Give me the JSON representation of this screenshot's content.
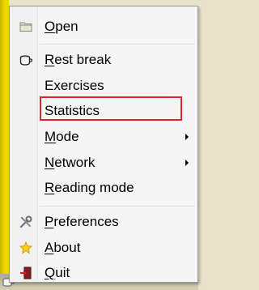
{
  "menu": {
    "items": [
      {
        "id": "open",
        "label": "Open",
        "mnemonic": "O",
        "rest": "pen",
        "icon": "folder-icon",
        "submenu": false
      },
      {
        "id": "rest-break",
        "label": "Rest break",
        "mnemonic": "R",
        "rest": "est break",
        "icon": "coffee-cup-icon",
        "submenu": false
      },
      {
        "id": "exercises",
        "label": "Exercises",
        "mnemonic": "",
        "rest": "Exercises",
        "icon": "",
        "submenu": false
      },
      {
        "id": "statistics",
        "label": "Statistics",
        "mnemonic": "",
        "rest": "Statistics",
        "icon": "",
        "submenu": false
      },
      {
        "id": "mode",
        "label": "Mode",
        "mnemonic": "M",
        "rest": "ode",
        "icon": "",
        "submenu": true
      },
      {
        "id": "network",
        "label": "Network",
        "mnemonic": "N",
        "rest": "etwork",
        "icon": "",
        "submenu": true
      },
      {
        "id": "reading-mode",
        "label": "Reading mode",
        "mnemonic": "R",
        "rest": "eading mode",
        "icon": "",
        "submenu": false
      },
      {
        "id": "preferences",
        "label": "Preferences",
        "mnemonic": "P",
        "rest": "references",
        "icon": "tools-icon",
        "submenu": false
      },
      {
        "id": "about",
        "label": "About",
        "mnemonic": "A",
        "rest": "bout",
        "icon": "star-icon",
        "submenu": false
      },
      {
        "id": "quit",
        "label": "Quit",
        "mnemonic": "Q",
        "rest": "uit",
        "icon": "exit-door-icon",
        "submenu": false
      }
    ],
    "highlighted_item": "statistics",
    "highlight_color": "#e8202c"
  },
  "colors": {
    "desktop_yellow": "#f2dc00",
    "menu_background": "#f5f5f5"
  }
}
